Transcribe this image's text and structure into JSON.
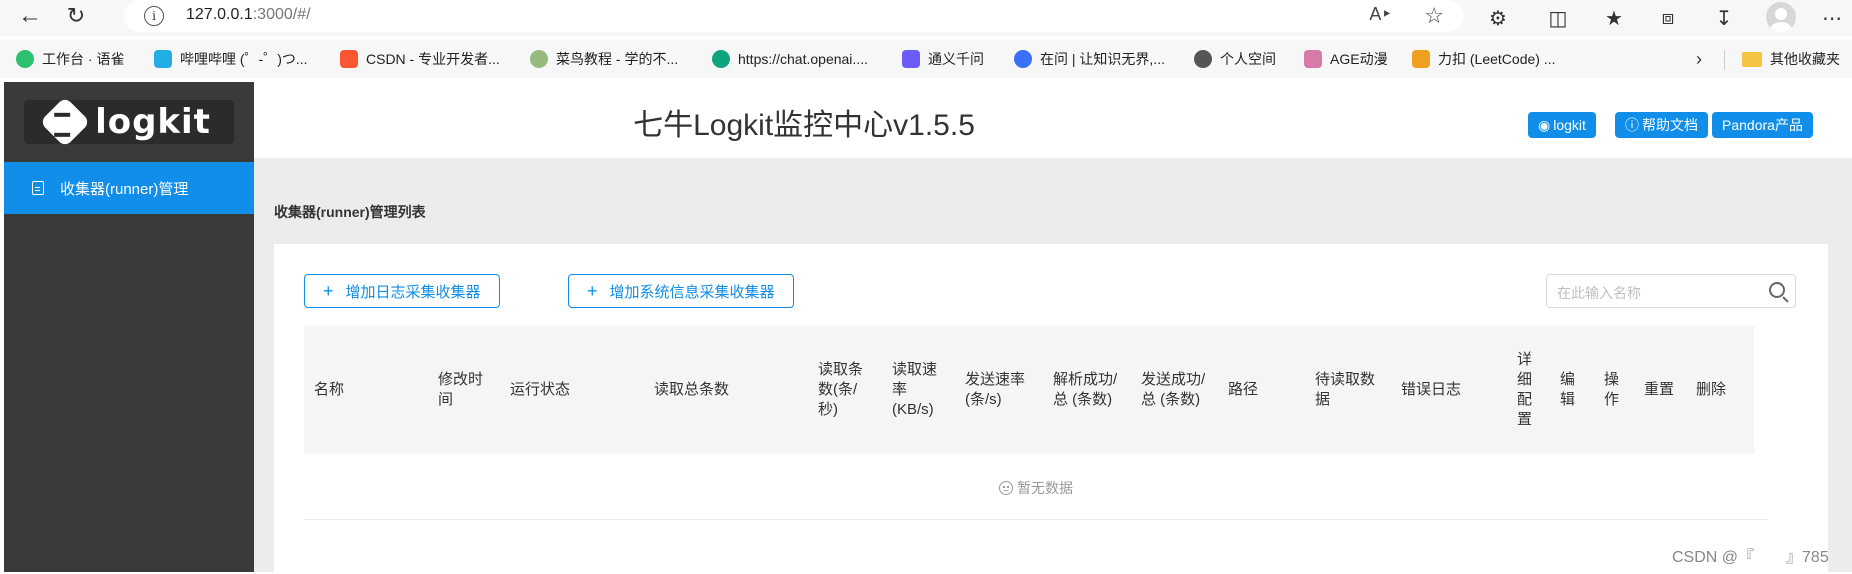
{
  "browser": {
    "url_host": "127.0.0.1",
    "url_rest": ":3000/#/",
    "bookmarks": [
      {
        "label": "工作台 · 语雀",
        "color": "#2fbf71"
      },
      {
        "label": "哔哩哔哩 (゜-゜)つ...",
        "color": "#23ade5"
      },
      {
        "label": "CSDN - 专业开发者...",
        "color": "#fc5531"
      },
      {
        "label": "菜鸟教程 - 学的不...",
        "color": "#96b97d"
      },
      {
        "label": "https://chat.openai....",
        "color": "#10a37f"
      },
      {
        "label": "通义千问",
        "color": "#6b5cf5"
      },
      {
        "label": "在问 | 让知识无界,...",
        "color": "#3a6ff7"
      },
      {
        "label": "个人空间",
        "color": "#555555"
      },
      {
        "label": "AGE动漫",
        "color": "#d87aa8"
      },
      {
        "label": "力扣 (LeetCode) ...",
        "color": "#f0a020"
      }
    ],
    "other_bookmarks": "其他收藏夹"
  },
  "sidebar": {
    "logo": "logkit",
    "menu_item": "收集器(runner)管理"
  },
  "header": {
    "title": "七牛Logkit监控中心v1.5.5",
    "buttons": {
      "github": "logkit",
      "help": "帮助文档",
      "pandora": "Pandora产品"
    }
  },
  "content": {
    "section_title": "收集器(runner)管理列表",
    "add_log_collector": "增加日志采集收集器",
    "add_system_collector": "增加系统信息采集收集器",
    "search_placeholder": "在此输入名称",
    "columns": {
      "name": "名称",
      "modified": "修改时间",
      "status": "运行状态",
      "read_total": "读取总条数",
      "read_rate": "读取条数(条/秒)",
      "read_speed": "读取速率(KB/s)",
      "send_rate": "发送速率(条/s)",
      "parse_success": "解析成功/总 (条数)",
      "send_success": "发送成功/总 (条数)",
      "path": "路径",
      "pending": "待读取数据",
      "error_log": "错误日志",
      "detail_config": "详细配置",
      "edit": "编辑",
      "operate": "操作",
      "reset": "重置",
      "delete": "删除"
    },
    "empty_text": "暂无数据"
  },
  "watermark": "CSDN @『　　』785"
}
